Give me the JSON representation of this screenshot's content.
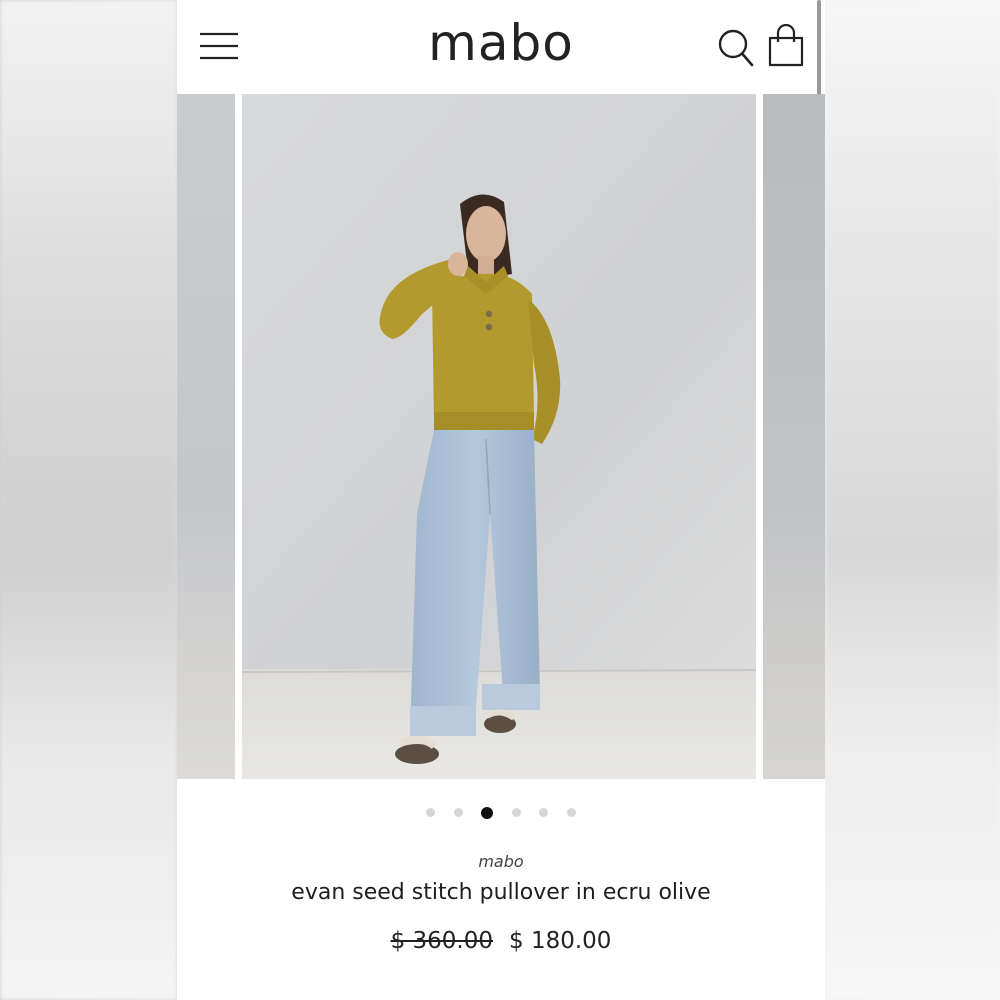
{
  "header": {
    "logo_text": "mabo",
    "menu_icon": "hamburger-menu-icon",
    "search_icon": "search-icon",
    "cart_icon": "shopping-bag-icon"
  },
  "carousel": {
    "slide_count": 6,
    "active_index": 2
  },
  "product": {
    "brand": "mabo",
    "title": "evan seed stitch pullover in ecru olive",
    "original_price": "$ 360.00",
    "sale_price": "$ 180.00"
  },
  "colors": {
    "sweater": "#b39a2e",
    "jeans": "#a9bfd6",
    "wall": "#d4d5d7",
    "floor": "#e2e1de",
    "active_dot": "#111111",
    "inactive_dot": "#d6d6d6"
  }
}
